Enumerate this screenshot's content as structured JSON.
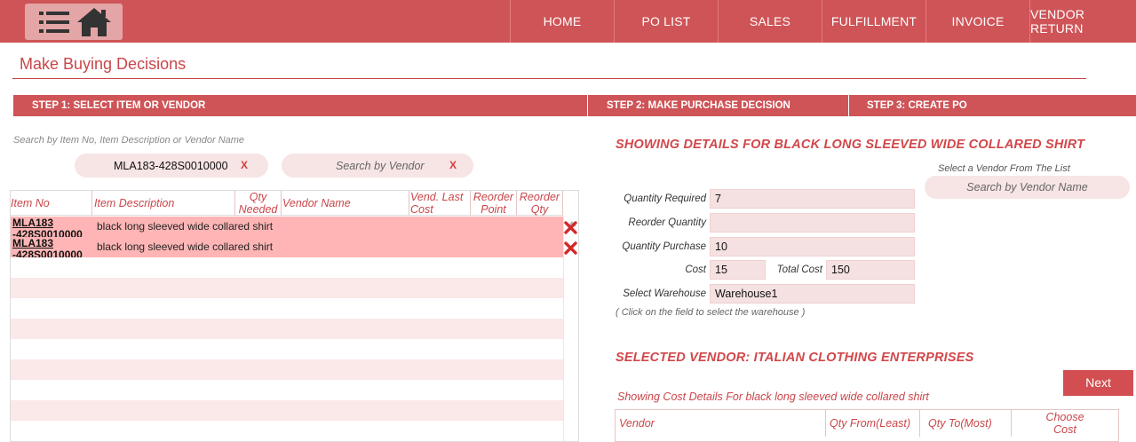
{
  "nav": {
    "items": [
      "HOME",
      "PO LIST",
      "SALES",
      "FULFILLMENT",
      "INVOICE",
      "VENDOR RETURN"
    ]
  },
  "page": {
    "title": "Make Buying Decisions"
  },
  "steps": {
    "step1": "STEP 1: SELECT ITEM OR VENDOR",
    "step2": "STEP 2: MAKE PURCHASE DECISION",
    "step3": "STEP 3: CREATE PO"
  },
  "search": {
    "hint": "Search by Item No, Item Description or Vendor Name",
    "item_value": "MLA183-428S0010000",
    "item_clear": "X",
    "vendor_placeholder": "Search by Vendor",
    "vendor_clear": "X"
  },
  "items_table": {
    "headers": {
      "item_no": "Item No",
      "item_description": "Item Description",
      "qty_needed": [
        "Qty",
        "Needed"
      ],
      "vendor_name": "Vendor Name",
      "vend_last_cost": [
        "Vend. Last",
        "Cost"
      ],
      "reorder_point": [
        "Reorder",
        "Point"
      ],
      "reorder_qty": [
        "Reorder",
        "Qty"
      ]
    },
    "rows": [
      {
        "item_no": "MLA183 -428S0010000",
        "description": "black long sleeved wide collared shirt"
      },
      {
        "item_no": "MLA183 -428S0010000",
        "description": "black long sleeved wide collared shirt"
      }
    ]
  },
  "details": {
    "title": "SHOWING DETAILS FOR  BLACK LONG SLEEVED WIDE COLLARED SHIRT",
    "vendor_hint": "Select a Vendor From The List",
    "vendor_search_placeholder": "Search by Vendor Name",
    "fields": {
      "quantity_required": {
        "label": "Quantity Required",
        "value": "7"
      },
      "reorder_quantity": {
        "label": "Reorder Quantity",
        "value": ""
      },
      "quantity_purchase": {
        "label": "Quantity Purchase",
        "value": "10"
      },
      "cost": {
        "label": "Cost",
        "value": "15"
      },
      "total_cost": {
        "label": "Total Cost",
        "value": "150"
      },
      "warehouse": {
        "label": "Select Warehouse",
        "value": "Warehouse1"
      }
    },
    "warehouse_note": "( Click on the field to select the warehouse )",
    "selected_vendor": "SELECTED VENDOR: ITALIAN CLOTHING ENTERPRISES",
    "next_label": "Next",
    "cost_note": "Showing Cost Details For black long sleeved wide collared shirt",
    "vendor_table": {
      "vendor": "Vendor",
      "qty_from": "Qty From(Least)",
      "qty_to": "Qty To(Most)",
      "choose_cost": [
        "Choose",
        "Cost"
      ]
    }
  },
  "colors": {
    "brand": "#cf5457",
    "accent_text": "#c9464a",
    "selected_row": "#ffb5b5"
  },
  "icons": [
    "menu-icon",
    "home-icon",
    "delete-icon",
    "scroll-up-icon"
  ]
}
